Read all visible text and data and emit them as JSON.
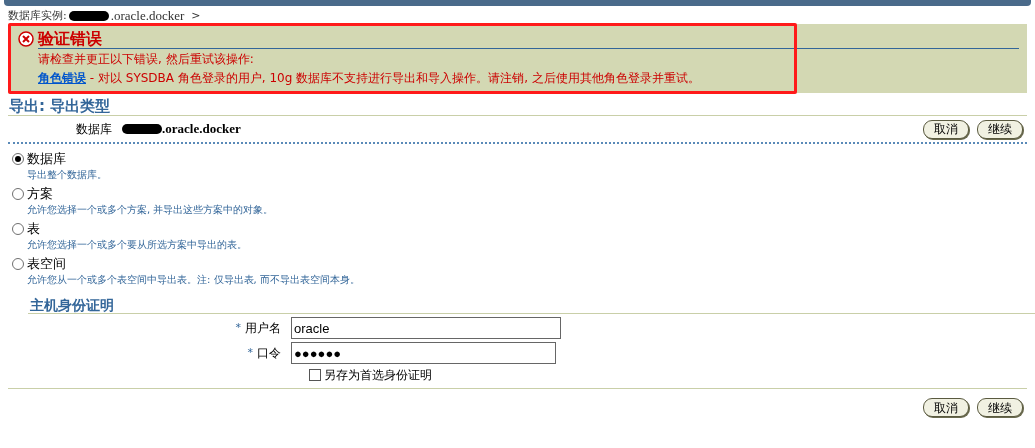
{
  "breadcrumb": {
    "label": "数据库实例:",
    "host": ".oracle.docker",
    "separator": ">"
  },
  "error": {
    "title": "验证错误",
    "intro": "请检查并更正以下错误, 然后重试该操作:",
    "link": "角色错误",
    "message": " - 对以 SYSDBA 角色登录的用户, 10g 数据库不支持进行导出和导入操作。请注销, 之后使用其他角色登录并重试。"
  },
  "page_title": "导出: 导出类型",
  "database": {
    "label": "数据库",
    "value": ".oracle.docker"
  },
  "buttons": [
    "取消",
    "继续"
  ],
  "export_types": [
    {
      "label": "数据库",
      "description": "导出整个数据库。",
      "selected": true
    },
    {
      "label": "方案",
      "description": "允许您选择一个或多个方案, 并导出这些方案中的对象。",
      "selected": false
    },
    {
      "label": "表",
      "description": "允许您选择一个或多个要从所选方案中导出的表。",
      "selected": false
    },
    {
      "label": "表空间",
      "description": "允许您从一个或多个表空间中导出表。注: 仅导出表, 而不导出表空间本身。",
      "selected": false
    }
  ],
  "host_credentials": {
    "title": "主机身份证明",
    "fields": [
      {
        "marker": "*",
        "label": "用户名",
        "value": "oracle"
      },
      {
        "marker": "*",
        "label": "口令",
        "value": "●●●●●●"
      }
    ],
    "save_preferred": {
      "label": "另存为首选身份证明",
      "checked": false
    }
  },
  "bottom_buttons": [
    "取消",
    "继续"
  ]
}
